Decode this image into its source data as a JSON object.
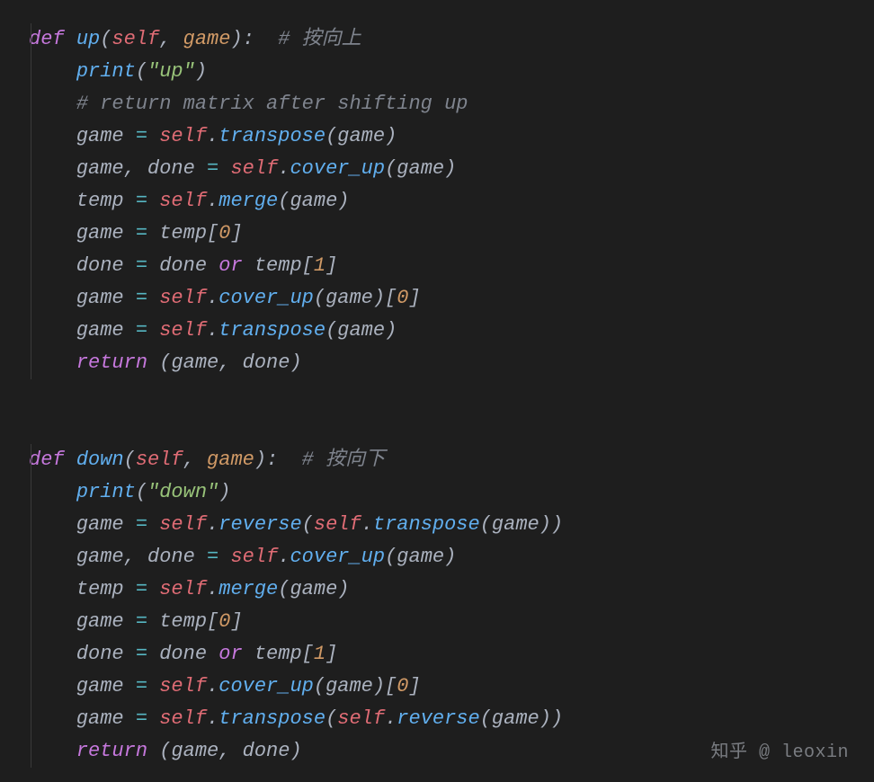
{
  "code": {
    "lines": [
      {
        "indent": 0,
        "tokens": [
          [
            "kw",
            "def"
          ],
          [
            "plain",
            " "
          ],
          [
            "fn",
            "up"
          ],
          [
            "punct",
            "("
          ],
          [
            "self",
            "self"
          ],
          [
            "punct",
            ", "
          ],
          [
            "param",
            "game"
          ],
          [
            "punct",
            "):  "
          ],
          [
            "cmt",
            "# 按向上"
          ]
        ]
      },
      {
        "indent": 1,
        "tokens": [
          [
            "fn",
            "print"
          ],
          [
            "punct",
            "("
          ],
          [
            "str",
            "\"up\""
          ],
          [
            "punct",
            ")"
          ]
        ]
      },
      {
        "indent": 1,
        "tokens": [
          [
            "cmt",
            "# return matrix after shifting up"
          ]
        ]
      },
      {
        "indent": 1,
        "tokens": [
          [
            "plain",
            "game "
          ],
          [
            "op",
            "="
          ],
          [
            "plain",
            " "
          ],
          [
            "self",
            "self"
          ],
          [
            "punct",
            "."
          ],
          [
            "fn",
            "transpose"
          ],
          [
            "punct",
            "("
          ],
          [
            "plain",
            "game"
          ],
          [
            "punct",
            ")"
          ]
        ]
      },
      {
        "indent": 1,
        "tokens": [
          [
            "plain",
            "game"
          ],
          [
            "punct",
            ", "
          ],
          [
            "plain",
            "done "
          ],
          [
            "op",
            "="
          ],
          [
            "plain",
            " "
          ],
          [
            "self",
            "self"
          ],
          [
            "punct",
            "."
          ],
          [
            "fn",
            "cover_up"
          ],
          [
            "punct",
            "("
          ],
          [
            "plain",
            "game"
          ],
          [
            "punct",
            ")"
          ]
        ]
      },
      {
        "indent": 1,
        "tokens": [
          [
            "plain",
            "temp "
          ],
          [
            "op",
            "="
          ],
          [
            "plain",
            " "
          ],
          [
            "self",
            "self"
          ],
          [
            "punct",
            "."
          ],
          [
            "fn",
            "merge"
          ],
          [
            "punct",
            "("
          ],
          [
            "plain",
            "game"
          ],
          [
            "punct",
            ")"
          ]
        ]
      },
      {
        "indent": 1,
        "tokens": [
          [
            "plain",
            "game "
          ],
          [
            "op",
            "="
          ],
          [
            "plain",
            " temp"
          ],
          [
            "punct",
            "["
          ],
          [
            "num",
            "0"
          ],
          [
            "punct",
            "]"
          ]
        ]
      },
      {
        "indent": 1,
        "tokens": [
          [
            "plain",
            "done "
          ],
          [
            "op",
            "="
          ],
          [
            "plain",
            " done "
          ],
          [
            "kw",
            "or"
          ],
          [
            "plain",
            " temp"
          ],
          [
            "punct",
            "["
          ],
          [
            "num",
            "1"
          ],
          [
            "punct",
            "]"
          ]
        ]
      },
      {
        "indent": 1,
        "tokens": [
          [
            "plain",
            "game "
          ],
          [
            "op",
            "="
          ],
          [
            "plain",
            " "
          ],
          [
            "self",
            "self"
          ],
          [
            "punct",
            "."
          ],
          [
            "fn",
            "cover_up"
          ],
          [
            "punct",
            "("
          ],
          [
            "plain",
            "game"
          ],
          [
            "punct",
            ")["
          ],
          [
            "num",
            "0"
          ],
          [
            "punct",
            "]"
          ]
        ]
      },
      {
        "indent": 1,
        "tokens": [
          [
            "plain",
            "game "
          ],
          [
            "op",
            "="
          ],
          [
            "plain",
            " "
          ],
          [
            "self",
            "self"
          ],
          [
            "punct",
            "."
          ],
          [
            "fn",
            "transpose"
          ],
          [
            "punct",
            "("
          ],
          [
            "plain",
            "game"
          ],
          [
            "punct",
            ")"
          ]
        ]
      },
      {
        "indent": 1,
        "tokens": [
          [
            "kw",
            "return"
          ],
          [
            "plain",
            " "
          ],
          [
            "punct",
            "("
          ],
          [
            "plain",
            "game"
          ],
          [
            "punct",
            ", "
          ],
          [
            "plain",
            "done"
          ],
          [
            "punct",
            ")"
          ]
        ]
      },
      {
        "blank": true
      },
      {
        "blank": true
      },
      {
        "indent": 0,
        "tokens": [
          [
            "kw",
            "def"
          ],
          [
            "plain",
            " "
          ],
          [
            "fn",
            "down"
          ],
          [
            "punct",
            "("
          ],
          [
            "self",
            "self"
          ],
          [
            "punct",
            ", "
          ],
          [
            "param",
            "game"
          ],
          [
            "punct",
            "):  "
          ],
          [
            "cmt",
            "# 按向下"
          ]
        ]
      },
      {
        "indent": 1,
        "tokens": [
          [
            "fn",
            "print"
          ],
          [
            "punct",
            "("
          ],
          [
            "str",
            "\"down\""
          ],
          [
            "punct",
            ")"
          ]
        ]
      },
      {
        "indent": 1,
        "tokens": [
          [
            "plain",
            "game "
          ],
          [
            "op",
            "="
          ],
          [
            "plain",
            " "
          ],
          [
            "self",
            "self"
          ],
          [
            "punct",
            "."
          ],
          [
            "fn",
            "reverse"
          ],
          [
            "punct",
            "("
          ],
          [
            "self",
            "self"
          ],
          [
            "punct",
            "."
          ],
          [
            "fn",
            "transpose"
          ],
          [
            "punct",
            "("
          ],
          [
            "plain",
            "game"
          ],
          [
            "punct",
            "))"
          ]
        ]
      },
      {
        "indent": 1,
        "tokens": [
          [
            "plain",
            "game"
          ],
          [
            "punct",
            ", "
          ],
          [
            "plain",
            "done "
          ],
          [
            "op",
            "="
          ],
          [
            "plain",
            " "
          ],
          [
            "self",
            "self"
          ],
          [
            "punct",
            "."
          ],
          [
            "fn",
            "cover_up"
          ],
          [
            "punct",
            "("
          ],
          [
            "plain",
            "game"
          ],
          [
            "punct",
            ")"
          ]
        ]
      },
      {
        "indent": 1,
        "tokens": [
          [
            "plain",
            "temp "
          ],
          [
            "op",
            "="
          ],
          [
            "plain",
            " "
          ],
          [
            "self",
            "self"
          ],
          [
            "punct",
            "."
          ],
          [
            "fn",
            "merge"
          ],
          [
            "punct",
            "("
          ],
          [
            "plain",
            "game"
          ],
          [
            "punct",
            ")"
          ]
        ]
      },
      {
        "indent": 1,
        "tokens": [
          [
            "plain",
            "game "
          ],
          [
            "op",
            "="
          ],
          [
            "plain",
            " temp"
          ],
          [
            "punct",
            "["
          ],
          [
            "num",
            "0"
          ],
          [
            "punct",
            "]"
          ]
        ]
      },
      {
        "indent": 1,
        "tokens": [
          [
            "plain",
            "done "
          ],
          [
            "op",
            "="
          ],
          [
            "plain",
            " done "
          ],
          [
            "kw",
            "or"
          ],
          [
            "plain",
            " temp"
          ],
          [
            "punct",
            "["
          ],
          [
            "num",
            "1"
          ],
          [
            "punct",
            "]"
          ]
        ]
      },
      {
        "indent": 1,
        "tokens": [
          [
            "plain",
            "game "
          ],
          [
            "op",
            "="
          ],
          [
            "plain",
            " "
          ],
          [
            "self",
            "self"
          ],
          [
            "punct",
            "."
          ],
          [
            "fn",
            "cover_up"
          ],
          [
            "punct",
            "("
          ],
          [
            "plain",
            "game"
          ],
          [
            "punct",
            ")["
          ],
          [
            "num",
            "0"
          ],
          [
            "punct",
            "]"
          ]
        ]
      },
      {
        "indent": 1,
        "tokens": [
          [
            "plain",
            "game "
          ],
          [
            "op",
            "="
          ],
          [
            "plain",
            " "
          ],
          [
            "self",
            "self"
          ],
          [
            "punct",
            "."
          ],
          [
            "fn",
            "transpose"
          ],
          [
            "punct",
            "("
          ],
          [
            "self",
            "self"
          ],
          [
            "punct",
            "."
          ],
          [
            "fn",
            "reverse"
          ],
          [
            "punct",
            "("
          ],
          [
            "plain",
            "game"
          ],
          [
            "punct",
            "))"
          ]
        ]
      },
      {
        "indent": 1,
        "tokens": [
          [
            "kw",
            "return"
          ],
          [
            "plain",
            " "
          ],
          [
            "punct",
            "("
          ],
          [
            "plain",
            "game"
          ],
          [
            "punct",
            ", "
          ],
          [
            "plain",
            "done"
          ],
          [
            "punct",
            ")"
          ]
        ]
      }
    ]
  },
  "watermark": "知乎 @ leoxin"
}
